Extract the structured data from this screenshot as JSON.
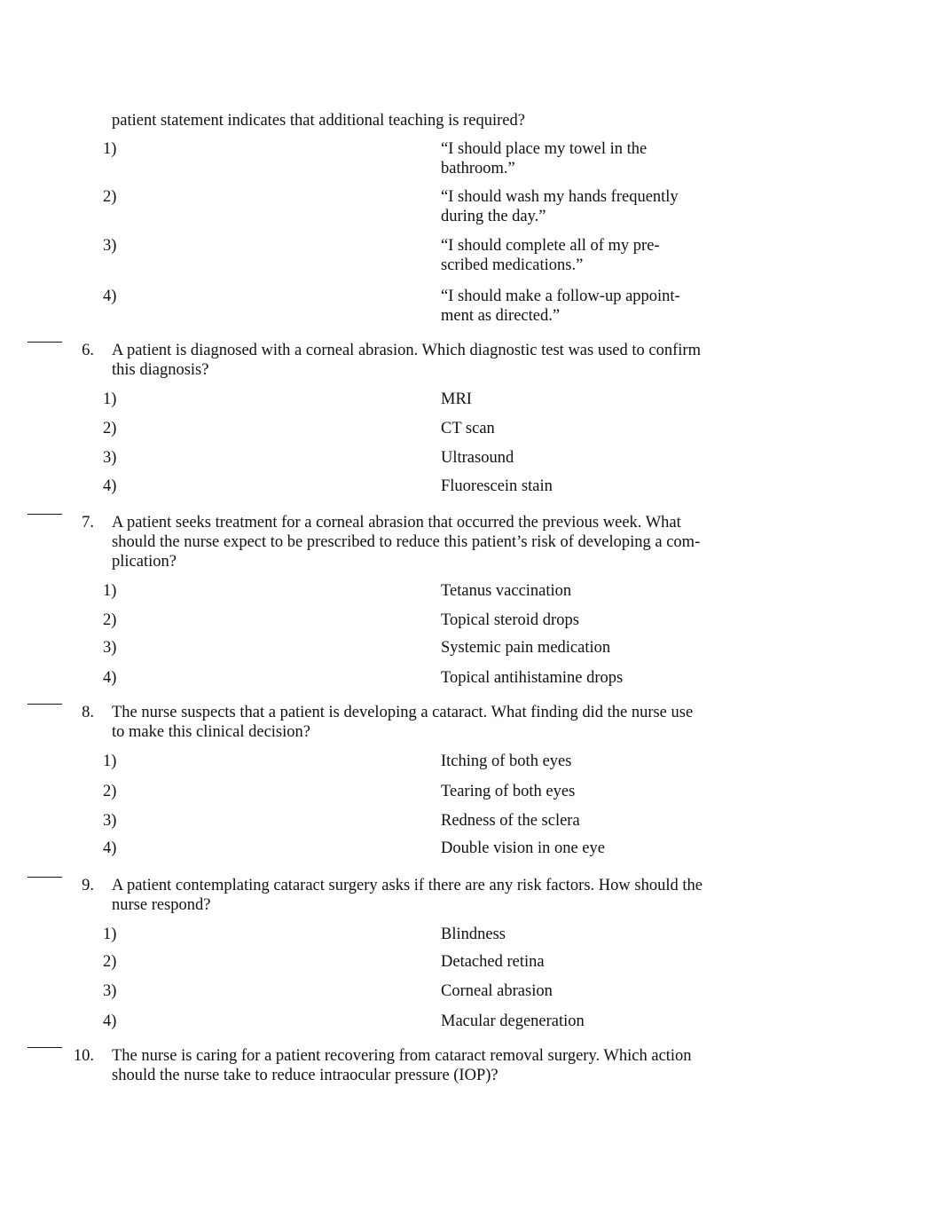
{
  "page": {
    "continued_stem": "patient statement indicates that additional teaching is required?",
    "continued_options": [
      {
        "num": "1)",
        "text_lines": [
          "“I should place my towel in the",
          "bathroom.”"
        ]
      },
      {
        "num": "2)",
        "text_lines": [
          "“I should wash my hands frequently",
          "during the day.”"
        ]
      },
      {
        "num": "3)",
        "text_lines": [
          "“I should complete all of my pre-",
          "scribed medications.”"
        ]
      },
      {
        "num": "4)",
        "text_lines": [
          "“I should make a follow-up appoint-",
          "ment as directed.”"
        ]
      }
    ],
    "questions": [
      {
        "number": "6.",
        "answer_blank": "",
        "stem_lines": [
          "A patient is diagnosed with a corneal abrasion. Which diagnostic test was used to confirm",
          "this diagnosis?"
        ],
        "options": [
          {
            "num": "1)",
            "text": "MRI"
          },
          {
            "num": "2)",
            "text": "CT scan"
          },
          {
            "num": "3)",
            "text": "Ultrasound"
          },
          {
            "num": "4)",
            "text": "Fluorescein stain"
          }
        ]
      },
      {
        "number": "7.",
        "answer_blank": "",
        "stem_lines": [
          "A patient seeks treatment for a corneal abrasion that occurred the previous week. What",
          "should the nurse expect to be prescribed to reduce this patient’s risk of developing a com-",
          "plication?"
        ],
        "options": [
          {
            "num": "1)",
            "text": "Tetanus vaccination"
          },
          {
            "num": "2)",
            "text": "Topical steroid drops"
          },
          {
            "num": "3)",
            "text": "Systemic pain medication"
          },
          {
            "num": "4)",
            "text": "Topical antihistamine drops"
          }
        ]
      },
      {
        "number": "8.",
        "answer_blank": "",
        "stem_lines": [
          "The nurse suspects that a patient is developing a cataract. What finding did the nurse use",
          "to make this clinical decision?"
        ],
        "options": [
          {
            "num": "1)",
            "text": "Itching of both eyes"
          },
          {
            "num": "2)",
            "text": "Tearing of both eyes"
          },
          {
            "num": "3)",
            "text": "Redness of the sclera"
          },
          {
            "num": "4)",
            "text": "Double vision in one eye"
          }
        ]
      },
      {
        "number": "9.",
        "answer_blank": "",
        "stem_lines": [
          "A patient contemplating cataract surgery asks if there are any risk factors. How should the",
          "nurse respond?"
        ],
        "options": [
          {
            "num": "1)",
            "text": "Blindness"
          },
          {
            "num": "2)",
            "text": "Detached retina"
          },
          {
            "num": "3)",
            "text": "Corneal abrasion"
          },
          {
            "num": "4)",
            "text": "Macular degeneration"
          }
        ]
      },
      {
        "number": "10.",
        "answer_blank": "",
        "stem_lines": [
          "The nurse is caring for a patient recovering from cataract removal surgery. Which action",
          "should the nurse take to reduce intraocular pressure (IOP)?"
        ],
        "options": []
      }
    ]
  }
}
